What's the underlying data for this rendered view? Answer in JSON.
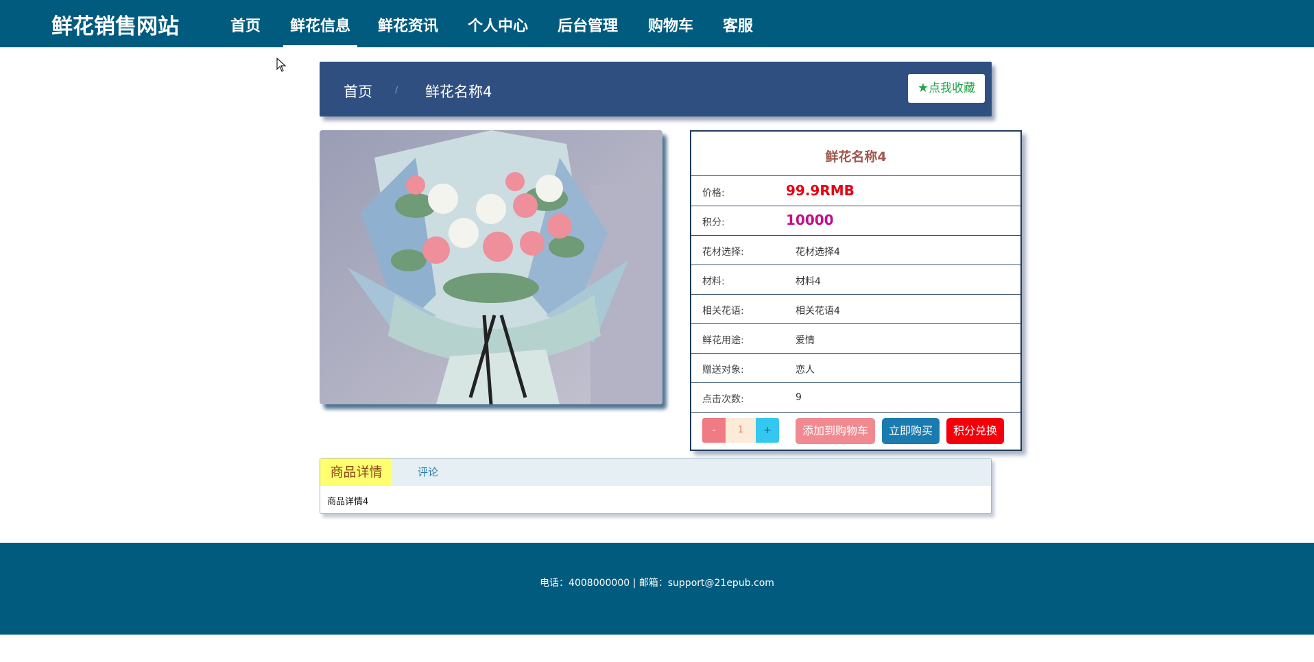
{
  "nav": {
    "brand": "鲜花销售网站",
    "items": [
      "首页",
      "鲜花信息",
      "鲜花资讯",
      "个人中心",
      "后台管理",
      "购物车",
      "客服"
    ]
  },
  "breadcrumb": {
    "home": "首页",
    "separator": "/",
    "current": "鲜花名称4",
    "favorite_label": "点我收藏"
  },
  "product": {
    "title": "鲜花名称4",
    "rows": [
      {
        "label": "价格:",
        "value": "99.9RMB"
      },
      {
        "label": "积分:",
        "value": "10000"
      },
      {
        "label": "花材选择:",
        "value": "花材选择4"
      },
      {
        "label": "材料:",
        "value": "材料4"
      },
      {
        "label": "相关花语:",
        "value": "相关花语4"
      },
      {
        "label": "鲜花用途:",
        "value": "爱情"
      },
      {
        "label": "赠送对象:",
        "value": "恋人"
      },
      {
        "label": "点击次数:",
        "value": "9"
      }
    ],
    "quantity": "1",
    "minus_label": "-",
    "plus_label": "+",
    "add_to_cart": "添加到购物车",
    "buy_now": "立即购买",
    "points_exchange": "积分兑换"
  },
  "tabs": {
    "details": "商品详情",
    "comments": "评论",
    "content": "商品详情4"
  },
  "footer": {
    "contact": "电话：4008000000 | 邮箱：support@21epub.com"
  },
  "colors": {
    "nav_bg": "#005b7f",
    "crumb_bg": "#2f4f81",
    "price": "#e60012",
    "points": "#c0108a"
  }
}
